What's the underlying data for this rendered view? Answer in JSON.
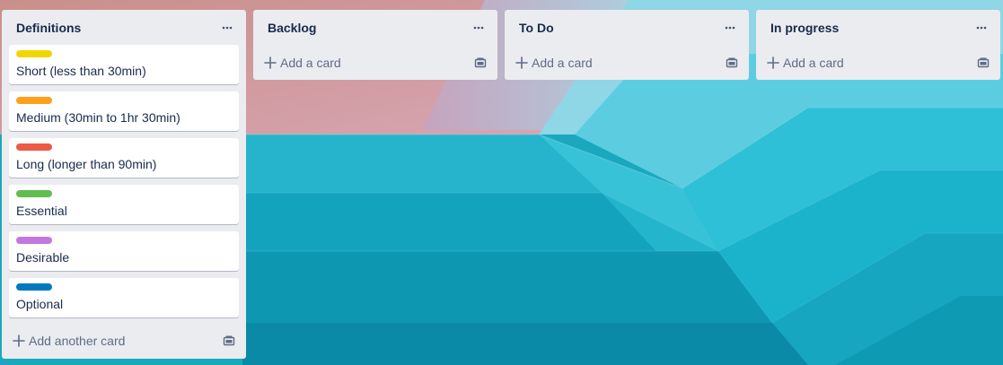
{
  "lists": [
    {
      "title": "Definitions",
      "cards": [
        {
          "text": "Short (less than 30min)",
          "label_color": "#f2d600"
        },
        {
          "text": "Medium (30min to 1hr 30min)",
          "label_color": "#ff9f1a"
        },
        {
          "text": "Long (longer than 90min)",
          "label_color": "#eb5a46"
        },
        {
          "text": "Essential",
          "label_color": "#61bd4f"
        },
        {
          "text": "Desirable",
          "label_color": "#c377e0"
        },
        {
          "text": "Optional",
          "label_color": "#0079bf"
        }
      ],
      "add_label": "Add another card"
    },
    {
      "title": "Backlog",
      "cards": [],
      "add_label": "Add a card"
    },
    {
      "title": "To Do",
      "cards": [],
      "add_label": "Add a card"
    },
    {
      "title": "In progress",
      "cards": [],
      "add_label": "Add a card"
    }
  ],
  "icons": {
    "menu": "ellipsis-icon",
    "add": "plus-icon",
    "template": "card-template-icon"
  }
}
